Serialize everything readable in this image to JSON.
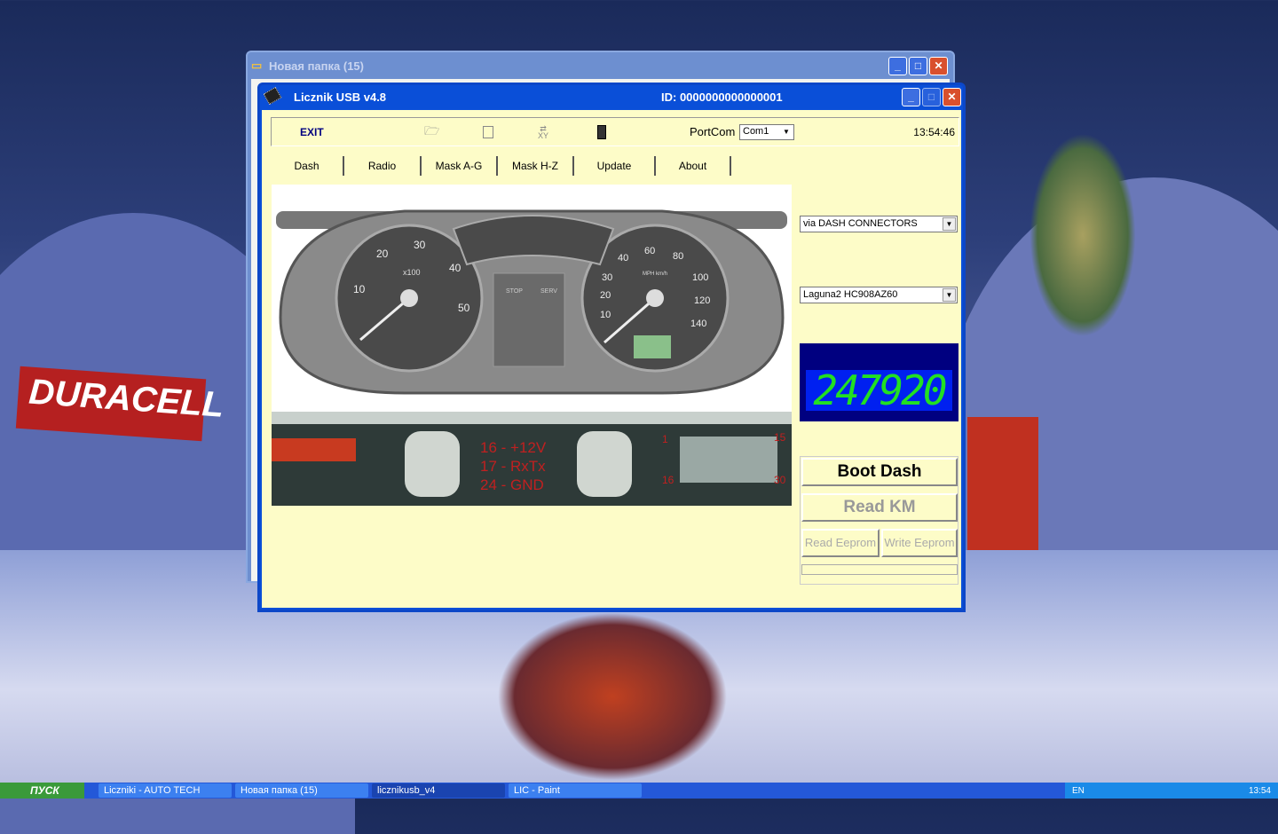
{
  "desktop": {
    "sign_text": "DURACELL"
  },
  "bg_window": {
    "title": "Новая папка (15)"
  },
  "app": {
    "title": "Licznik  USB   v4.8",
    "id_label": "ID:  0000000000000001",
    "toolbar": {
      "exit": "EXIT",
      "port_label": "PortCom",
      "port_value": "Com1",
      "time": "13:54:46",
      "xy_label": "XY"
    },
    "tabs": [
      "Dash",
      "Radio",
      "Mask  A-G",
      "Mask  H-Z",
      "Update",
      "About"
    ],
    "connection_select": "via DASH CONNECTORS",
    "model_select": "Laguna2  HC908AZ60",
    "odometer": "247920",
    "buttons": {
      "boot": "Boot  Dash",
      "read_km": "Read  KM",
      "read_eeprom": "Read Eeprom",
      "write_eeprom": "Write Eeprom"
    },
    "pinout": [
      "16 - +12V",
      "17 - RxTx",
      "24 - GND"
    ],
    "connector_pins": [
      "1",
      "15",
      "16",
      "30"
    ],
    "gauge_labels": {
      "rpm": [
        "10",
        "20",
        "30",
        "40",
        "50"
      ],
      "rpm_unit": "x100",
      "speed": [
        "10",
        "20",
        "30",
        "40",
        "60",
        "80",
        "100",
        "120",
        "140"
      ],
      "speed_unit": "MPH km/h",
      "warn": [
        "STOP",
        "SERV"
      ]
    }
  },
  "taskbar": {
    "start": "пуск",
    "items": [
      "Liczniki - AUTO TECH",
      "Новая папка (15)",
      "licznikusb_v4",
      "LIC - Paint"
    ],
    "lang": "EN",
    "clock": "13:54"
  },
  "colors": {
    "title_bar": "#0a4fd8",
    "client_bg": "#fdfcc8",
    "lcd_bg": "#000080",
    "lcd_digits": "#22e022"
  }
}
